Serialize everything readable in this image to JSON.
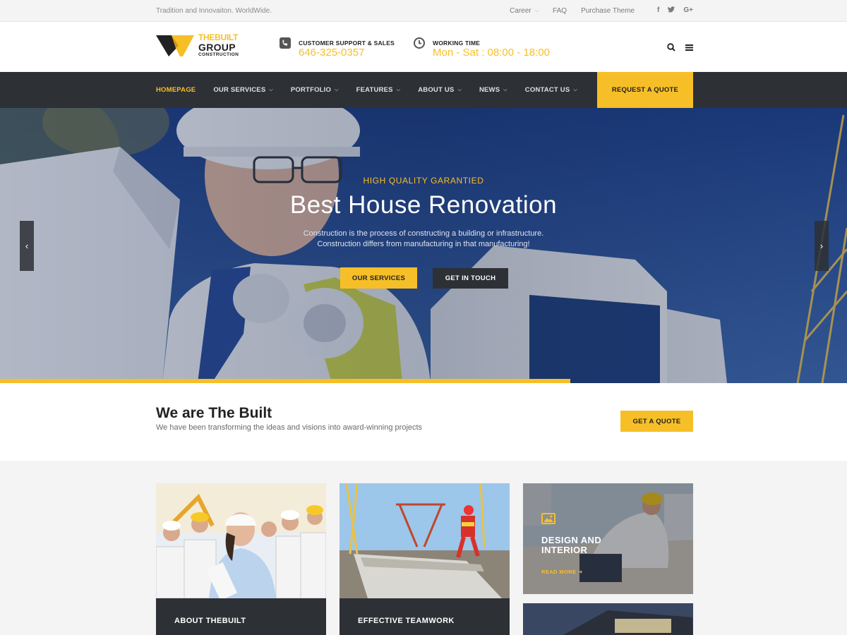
{
  "topbar": {
    "tagline": "Tradition and Innovaiton. WorldWide.",
    "links": [
      "Career",
      "FAQ",
      "Purchase Theme"
    ],
    "social_icons": [
      "facebook-icon",
      "twitter-icon",
      "google-plus-icon"
    ],
    "social_glyphs": [
      "f",
      "•",
      "G+"
    ]
  },
  "header": {
    "logo": {
      "line1": "THEBUILT",
      "line2": "GROUP",
      "line3": "CONSTRUCTION"
    },
    "support": {
      "title": "CUSTOMER SUPPORT & SALES",
      "value": "646-325-0357",
      "icon": "phone-icon"
    },
    "hours": {
      "title": "WORKING TIME",
      "value": "Mon - Sat : 08:00 - 18:00",
      "icon": "clock-icon"
    },
    "icons": [
      "search-icon",
      "menu-icon"
    ]
  },
  "nav": {
    "items": [
      {
        "label": "HOMEPAGE",
        "active": true,
        "dropdown": false
      },
      {
        "label": "OUR SERVICES",
        "active": false,
        "dropdown": true
      },
      {
        "label": "PORTFOLIO",
        "active": false,
        "dropdown": true
      },
      {
        "label": "FEATURES",
        "active": false,
        "dropdown": true
      },
      {
        "label": "ABOUT US",
        "active": false,
        "dropdown": true
      },
      {
        "label": "NEWS",
        "active": false,
        "dropdown": true
      },
      {
        "label": "CONTACT US",
        "active": false,
        "dropdown": true
      }
    ],
    "cta": "REQUEST A QUOTE"
  },
  "hero": {
    "kicker": "HIGH QUALITY GARANTIED",
    "title": "Best House Renovation",
    "desc_line1": "Construction is the process of constructing a building or infrastructure.",
    "desc_line2": "Construction differs from manufacturing in that manufacturing!",
    "btn_primary": "OUR SERVICES",
    "btn_secondary": "GET IN TOUCH",
    "prev_icon": "chevron-left-icon",
    "next_icon": "chevron-right-icon",
    "slide_progress": 0.673
  },
  "intro": {
    "title": "We are The Built",
    "subtitle": "We have been transforming the ideas and visions into award-winning projects",
    "button": "GET A QUOTE"
  },
  "cards": [
    {
      "caption": "ABOUT THEBUILT"
    },
    {
      "caption": "EFFECTIVE TEAMWORK"
    },
    {
      "title_line1": "DESIGN AND",
      "title_line2": "INTERIOR",
      "link": "READ MORE",
      "icon": "image-icon"
    }
  ],
  "colors": {
    "accent": "#f7bf27",
    "dark": "#2d3035",
    "hero_blue": "#2b4c8a",
    "light_bg": "#f4f4f4"
  }
}
